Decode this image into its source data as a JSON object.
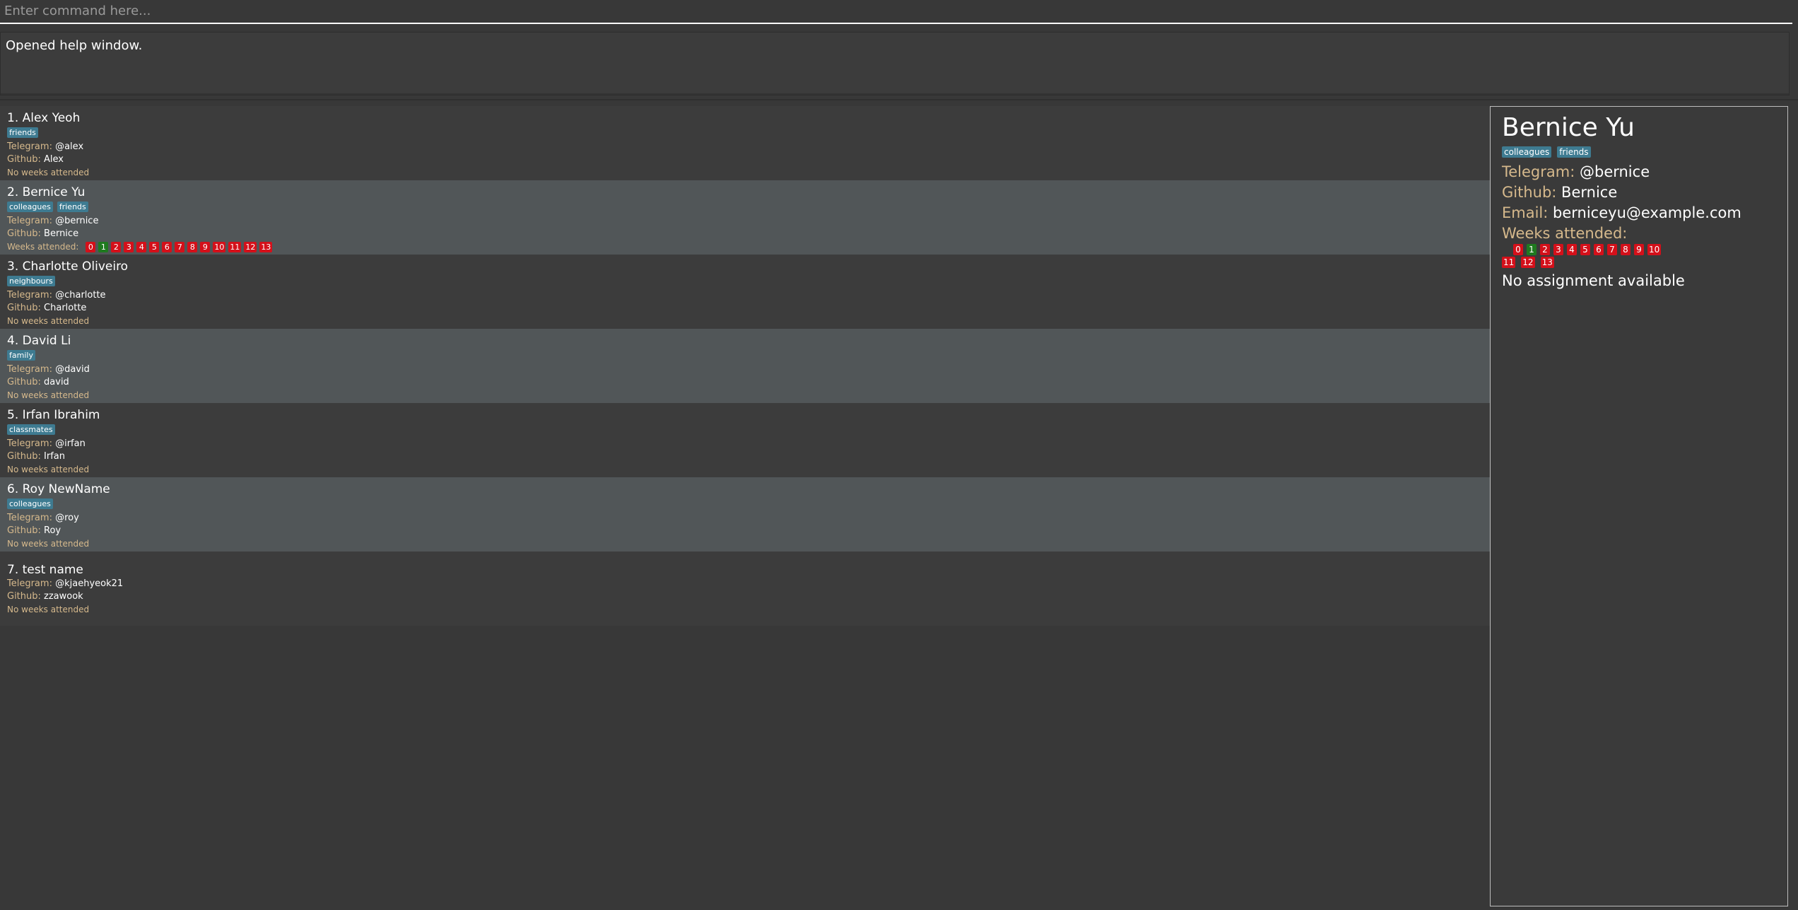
{
  "command": {
    "placeholder": "Enter command here...",
    "value": ""
  },
  "result": {
    "text": "Opened help window."
  },
  "labels": {
    "telegram": "Telegram: ",
    "github": "Github: ",
    "email": "Email: ",
    "weeks_attended": "Weeks attended:",
    "no_weeks": "No weeks attended"
  },
  "persons": [
    {
      "index_name": "1. Alex Yeoh",
      "tags": [
        "friends"
      ],
      "telegram": "@alex",
      "github": "Alex",
      "weeks_text": "No weeks attended"
    },
    {
      "index_name": "2. Bernice Yu",
      "tags": [
        "colleagues",
        "friends"
      ],
      "telegram": "@bernice",
      "github": "Bernice",
      "weeks_text": "Weeks attended:",
      "weeks": [
        {
          "label": "0",
          "attended": false
        },
        {
          "label": "1",
          "attended": true
        },
        {
          "label": "2",
          "attended": false
        },
        {
          "label": "3",
          "attended": false
        },
        {
          "label": "4",
          "attended": false
        },
        {
          "label": "5",
          "attended": false
        },
        {
          "label": "6",
          "attended": false
        },
        {
          "label": "7",
          "attended": false
        },
        {
          "label": "8",
          "attended": false
        },
        {
          "label": "9",
          "attended": false
        },
        {
          "label": "10",
          "attended": false
        },
        {
          "label": "11",
          "attended": false
        },
        {
          "label": "12",
          "attended": false
        },
        {
          "label": "13",
          "attended": false
        }
      ]
    },
    {
      "index_name": "3. Charlotte Oliveiro",
      "tags": [
        "neighbours"
      ],
      "telegram": "@charlotte",
      "github": "Charlotte",
      "weeks_text": "No weeks attended"
    },
    {
      "index_name": "4. David Li",
      "tags": [
        "family"
      ],
      "telegram": "@david",
      "github": "david",
      "weeks_text": "No weeks attended"
    },
    {
      "index_name": "5. Irfan Ibrahim",
      "tags": [
        "classmates"
      ],
      "telegram": "@irfan",
      "github": "Irfan",
      "weeks_text": "No weeks attended"
    },
    {
      "index_name": "6. Roy NewName",
      "tags": [
        "colleagues"
      ],
      "telegram": "@roy",
      "github": "Roy",
      "weeks_text": "No weeks attended"
    },
    {
      "index_name": "7. test name",
      "tags": [],
      "telegram": "@kjaehyeok21",
      "github": "zzawook",
      "weeks_text": "No weeks attended"
    }
  ],
  "detail": {
    "name": "Bernice Yu",
    "tags": [
      "colleagues",
      "friends"
    ],
    "telegram": "@bernice",
    "github": "Bernice",
    "email": "berniceyu@example.com",
    "weeks_row1": [
      {
        "label": "0",
        "attended": false
      },
      {
        "label": "1",
        "attended": true
      },
      {
        "label": "2",
        "attended": false
      },
      {
        "label": "3",
        "attended": false
      },
      {
        "label": "4",
        "attended": false
      },
      {
        "label": "5",
        "attended": false
      },
      {
        "label": "6",
        "attended": false
      },
      {
        "label": "7",
        "attended": false
      },
      {
        "label": "8",
        "attended": false
      },
      {
        "label": "9",
        "attended": false
      },
      {
        "label": "10",
        "attended": false
      }
    ],
    "weeks_row2": [
      {
        "label": "11",
        "attended": false
      },
      {
        "label": "12",
        "attended": false
      },
      {
        "label": "13",
        "attended": false
      }
    ],
    "assignment": "No assignment available"
  },
  "colors": {
    "background": "#383838",
    "card_alt": "#515658",
    "tag": "#3e7b91",
    "label": "#d6b98c",
    "week_absent": "#d4101a",
    "week_present": "#1f7a1f"
  }
}
